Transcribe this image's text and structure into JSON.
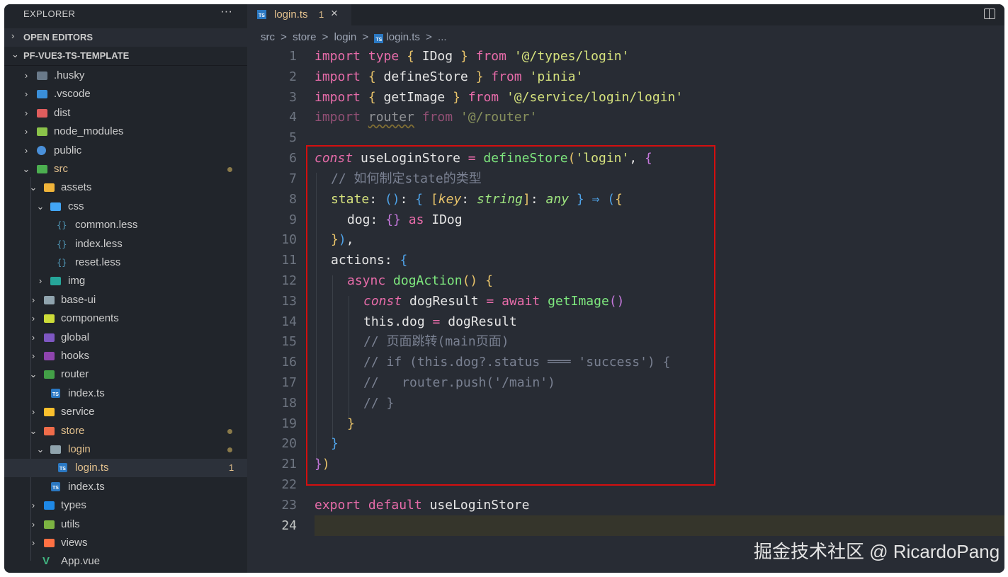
{
  "sidebar": {
    "title": "EXPLORER",
    "more": "···",
    "open_editors": "OPEN EDITORS",
    "project": "PF-VUE3-TS-TEMPLATE",
    "items": [
      {
        "label": ".husky"
      },
      {
        "label": ".vscode"
      },
      {
        "label": "dist"
      },
      {
        "label": "node_modules"
      },
      {
        "label": "public"
      },
      {
        "label": "src"
      },
      {
        "label": "assets"
      },
      {
        "label": "css"
      },
      {
        "label": "common.less"
      },
      {
        "label": "index.less"
      },
      {
        "label": "reset.less"
      },
      {
        "label": "img"
      },
      {
        "label": "base-ui"
      },
      {
        "label": "components"
      },
      {
        "label": "global"
      },
      {
        "label": "hooks"
      },
      {
        "label": "router"
      },
      {
        "label": "index.ts"
      },
      {
        "label": "service"
      },
      {
        "label": "store"
      },
      {
        "label": "login"
      },
      {
        "label": "login.ts",
        "badge": "1"
      },
      {
        "label": "index.ts"
      },
      {
        "label": "types"
      },
      {
        "label": "utils"
      },
      {
        "label": "views"
      },
      {
        "label": "App.vue"
      }
    ]
  },
  "tab": {
    "label": "login.ts",
    "count": "1",
    "close": "×",
    "icon": "TS"
  },
  "breadcrumb": [
    "src",
    ">",
    "store",
    ">",
    "login",
    ">",
    "login.ts",
    ">",
    "..."
  ],
  "line_numbers": [
    "1",
    "2",
    "3",
    "4",
    "5",
    "6",
    "7",
    "8",
    "9",
    "10",
    "11",
    "12",
    "13",
    "14",
    "15",
    "16",
    "17",
    "18",
    "19",
    "20",
    "21",
    "22",
    "23",
    "24"
  ],
  "code": {
    "l1": {
      "a": "import",
      "b": " type ",
      "c": "{",
      "d": " IDog ",
      "e": "}",
      "f": " from ",
      "g": "'@/types/login'"
    },
    "l2": {
      "a": "import",
      "c": " {",
      "d": " defineStore ",
      "e": "}",
      "f": " from ",
      "g": "'pinia'"
    },
    "l3": {
      "a": "import",
      "c": " {",
      "d": " getImage ",
      "e": "}",
      "f": " from ",
      "g": "'@/service/login/login'"
    },
    "l4": {
      "a": "import ",
      "d": "router",
      "f": " from ",
      "g": "'@/router'"
    },
    "l6": {
      "a": "const",
      "b": " useLoginStore ",
      "c": "=",
      "d": " defineStore",
      "e": "(",
      "g": "'login'",
      "h": ", ",
      "i": "{"
    },
    "l7": "// 如何制定state的类型",
    "l8": {
      "a": "state",
      "b": ": ",
      "c": "()",
      "d": ": ",
      "e": "{",
      "f": " [",
      "g": "key",
      "h": ": ",
      "i": "string",
      "j": "]",
      "k": ": ",
      "l": "any",
      "m": " }",
      "n": " ⇒ ",
      "o": "(",
      "p": "{"
    },
    "l9": {
      "a": "dog",
      "b": ": ",
      "c": "{}",
      "d": " as ",
      "e": "IDog"
    },
    "l10": {
      "a": "}",
      "b": ")",
      "c": ","
    },
    "l11": {
      "a": "actions",
      "b": ": ",
      "c": "{"
    },
    "l12": {
      "a": "async",
      "b": " dogAction",
      "c": "()",
      "d": " {"
    },
    "l13": {
      "a": "const",
      "b": " dogResult ",
      "c": "=",
      "d": " await",
      "e": " getImage",
      "f": "()"
    },
    "l14": {
      "a": "this.dog ",
      "b": "=",
      "c": " dogResult"
    },
    "l15": "// 页面跳转(main页面)",
    "l16": "// if (this.dog?.status ═══ 'success') {",
    "l17": "//   router.push('/main')",
    "l18": "// }",
    "l19": "}",
    "l20": "}",
    "l21": {
      "a": "}",
      "b": ")"
    },
    "l23": {
      "a": "export",
      "b": " default",
      "c": " useLoginStore"
    }
  },
  "watermark": "掘金技术社区 @ RicardoPang",
  "colors": {
    "highlight_box": "#d40f0f",
    "modified": "#e2c08d",
    "ts_icon": "#2b78c2"
  }
}
